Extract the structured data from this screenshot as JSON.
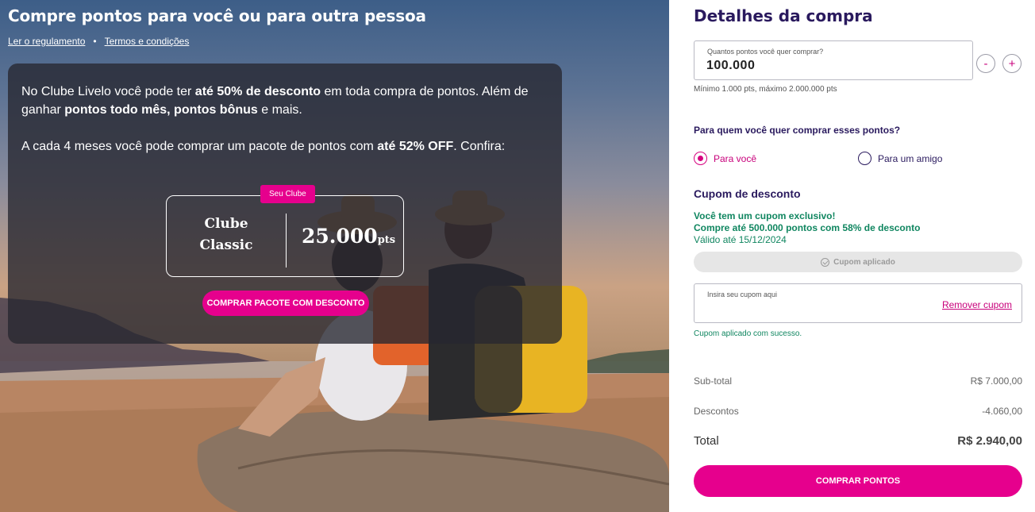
{
  "hero": {
    "title": "Compre pontos para você ou para outra pessoa",
    "link_regulamento": "Ler o regulamento",
    "link_separator": "•",
    "link_termos": "Termos e condições",
    "card": {
      "p1_a": "No Clube Livelo você pode ter ",
      "p1_b": "até 50% de desconto",
      "p1_c": " em toda compra de pontos. Além de ganhar ",
      "p1_d": "pontos todo mês, pontos bônus",
      "p1_e": " e mais.",
      "p2_a": "A cada 4 meses você pode comprar um pacote de pontos com ",
      "p2_b": "até 52% OFF",
      "p2_c": ". Confira:",
      "badge": "Seu Clube",
      "club_line1": "Clube",
      "club_line2": "Classic",
      "club_points": "25.000",
      "club_points_unit": "pts",
      "buy_pack_label": "COMPRAR PACOTE COM DESCONTO"
    }
  },
  "panel": {
    "title": "Detalhes da compra",
    "points_label": "Quantos pontos você quer comprar?",
    "points_value": "100.000",
    "minus_label": "-",
    "plus_label": "+",
    "range_hint": "Mínimo 1.000 pts, máximo 2.000.000 pts",
    "who_question": "Para quem você quer comprar esses pontos?",
    "radio_you": "Para você",
    "radio_friend": "Para um amigo",
    "coupon_heading": "Cupom de desconto",
    "coupon_msg_1": "Você tem um cupom exclusivo!",
    "coupon_msg_2": "Compre até 500.000 pontos com 58% de desconto",
    "coupon_msg_3": "Válido até 15/12/2024",
    "coupon_applied": "Cupom aplicado",
    "coupon_input_label": "Insira seu cupom aqui",
    "coupon_input_value": "",
    "coupon_remove": "Remover cupom",
    "coupon_success": "Cupom aplicado com sucesso.",
    "subtotal_label": "Sub-total",
    "subtotal_value": "R$ 7.000,00",
    "discount_label": "Descontos",
    "discount_value": "-4.060,00",
    "total_label": "Total",
    "total_value": "R$ 2.940,00",
    "buy_label": "COMPRAR PONTOS"
  },
  "colors": {
    "brand_pink": "#e6008d",
    "brand_navy": "#2a1a5e",
    "success_green": "#108660"
  }
}
